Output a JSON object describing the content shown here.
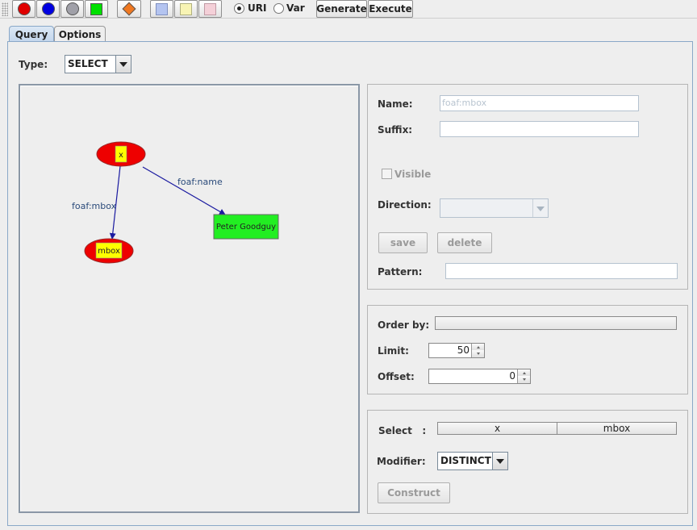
{
  "toolbar": {
    "tools": [
      {
        "name": "node-var-tool",
        "shape": "circle",
        "color": "#e00000"
      },
      {
        "name": "node-uri-tool",
        "shape": "circle",
        "color": "#0000e0"
      },
      {
        "name": "node-blank-tool",
        "shape": "circle",
        "color": "#a0a0a8"
      },
      {
        "name": "node-literal-tool",
        "shape": "square",
        "color": "#00e000"
      },
      {
        "name": "node-filter-tool",
        "shape": "diamond",
        "color": "#f07820"
      },
      {
        "name": "color-blue-tool",
        "shape": "square",
        "color": "#b4c4f0"
      },
      {
        "name": "color-yellow-tool",
        "shape": "square",
        "color": "#f8f4b4"
      },
      {
        "name": "color-pink-tool",
        "shape": "square",
        "color": "#f4d0d8"
      }
    ],
    "radio_uri": "URI",
    "radio_var": "Var",
    "selected_radio": "URI",
    "generate_label": "Generate",
    "execute_label": "Execute"
  },
  "tabs": [
    {
      "label": "Query",
      "active": true
    },
    {
      "label": "Options",
      "active": false
    }
  ],
  "query": {
    "type_label": "Type:",
    "type_value": "SELECT"
  },
  "graph": {
    "nodes": [
      {
        "id": "x",
        "label": "x",
        "kind": "variable",
        "fill": "#ee0000",
        "label_bg": "#ffff00"
      },
      {
        "id": "mbox",
        "label": "mbox",
        "kind": "variable",
        "fill": "#ee0000",
        "label_bg": "#ffff00"
      },
      {
        "id": "peter",
        "label": "Peter Goodguy",
        "kind": "literal",
        "fill": "#22ee22"
      }
    ],
    "edges": [
      {
        "from": "x",
        "to": "mbox",
        "label": "foaf:mbox"
      },
      {
        "from": "x",
        "to": "peter",
        "label": "foaf:name"
      }
    ],
    "edge_color": "#1a1aa0",
    "edge_label_color": "#2a4a7a"
  },
  "props": {
    "name_label": "Name:",
    "name_value": "foaf:mbox",
    "suffix_label": "Suffix:",
    "suffix_value": "",
    "visible_label": "Visible",
    "direction_label": "Direction:",
    "save_label": "save",
    "delete_label": "delete",
    "pattern_label": "Pattern:",
    "pattern_value": ""
  },
  "order": {
    "order_label": "Order by:",
    "order_value": "",
    "limit_label": "Limit:",
    "limit_value": "50",
    "offset_label": "Offset:",
    "offset_value": "0"
  },
  "select": {
    "select_label": "Select   :",
    "columns": [
      "x",
      "mbox"
    ],
    "modifier_label": "Modifier:",
    "modifier_value": "DISTINCT",
    "construct_label": "Construct"
  }
}
